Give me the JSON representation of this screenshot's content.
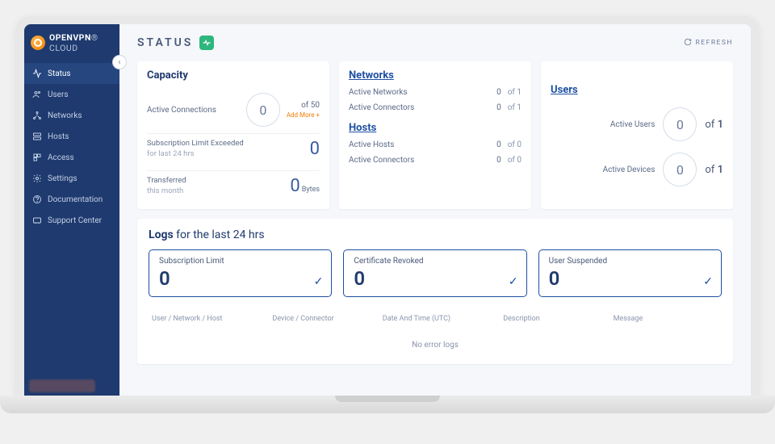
{
  "brand": {
    "name1": "OPENVPN",
    "name2": "CLOUD"
  },
  "sidebar": {
    "items": [
      {
        "label": "Status"
      },
      {
        "label": "Users"
      },
      {
        "label": "Networks"
      },
      {
        "label": "Hosts"
      },
      {
        "label": "Access"
      },
      {
        "label": "Settings"
      },
      {
        "label": "Documentation"
      },
      {
        "label": "Support Center"
      }
    ]
  },
  "header": {
    "title": "STATUS",
    "refresh": "REFRESH"
  },
  "capacity": {
    "title": "Capacity",
    "active_connections_label": "Active Connections",
    "active_connections_value": "0",
    "active_connections_of": "of 50",
    "add_more": "Add More +",
    "sub_limit_label": "Subscription Limit Exceeded",
    "sub_limit_sub": "for last 24 hrs",
    "sub_limit_value": "0",
    "transferred_label": "Transferred",
    "transferred_sub": "this month",
    "transferred_value": "0",
    "transferred_unit": "Bytes"
  },
  "networks": {
    "title": "Networks",
    "active_networks_label": "Active Networks",
    "active_networks_value": "0",
    "active_networks_of": "of 1",
    "active_connectors_label": "Active Connectors",
    "active_connectors_value": "0",
    "active_connectors_of": "of 1"
  },
  "hosts": {
    "title": "Hosts",
    "active_hosts_label": "Active Hosts",
    "active_hosts_value": "0",
    "active_hosts_of": "of 0",
    "active_connectors_label": "Active Connectors",
    "active_connectors_value": "0",
    "active_connectors_of": "of 0"
  },
  "users": {
    "title": "Users",
    "active_users_label": "Active Users",
    "active_users_value": "0",
    "active_users_of_prefix": "of",
    "active_users_of_n": "1",
    "active_devices_label": "Active Devices",
    "active_devices_value": "0",
    "active_devices_of_prefix": "of",
    "active_devices_of_n": "1"
  },
  "logs": {
    "title_bold": "Logs",
    "title_rest": " for the last 24 hrs",
    "boxes": [
      {
        "title": "Subscription Limit",
        "value": "0"
      },
      {
        "title": "Certificate Revoked",
        "value": "0"
      },
      {
        "title": "User Suspended",
        "value": "0"
      }
    ],
    "headers": [
      "User / Network / Host",
      "Device / Connector",
      "Date And Time (UTC)",
      "Description",
      "Message"
    ],
    "empty": "No error logs"
  }
}
